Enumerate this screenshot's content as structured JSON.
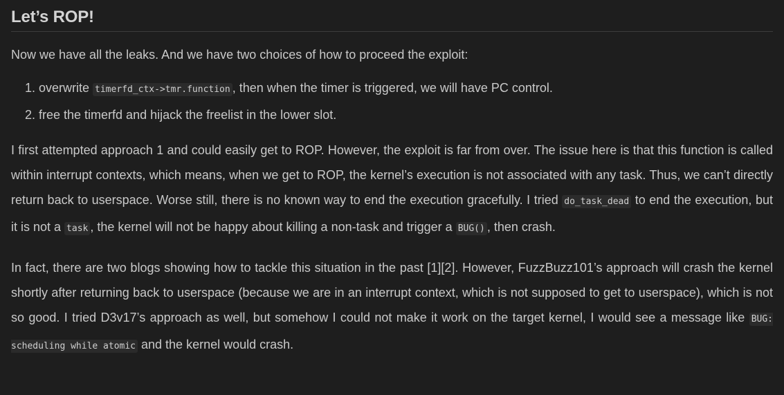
{
  "title": "Let’s ROP!",
  "intro": "Now we have all the leaks. And we have two choices of how to proceed the exploit:",
  "choices": [
    {
      "before": "overwrite ",
      "code": "timerfd_ctx->tmr.function",
      "after": ", then when the timer is triggered, we will have PC control."
    },
    {
      "text": "free the timerfd and hijack the freelist in the lower slot."
    }
  ],
  "para1": {
    "t1": "I first attempted approach 1 and could easily get to ROP. However, the exploit is far from over. The issue here is that this function is called within interrupt contexts, which means, when we get to ROP, the kernel’s execution is not associated with any task. Thus, we can’t directly return back to userspace. Worse still, there is no known way to end the execution gracefully. I tried ",
    "c1": "do_task_dead",
    "t2": " to end the execution, but it is not a ",
    "c2": "task",
    "t3": ", the kernel will not be happy about killing a non-task and trigger a ",
    "c3": "BUG()",
    "t4": ", then crash."
  },
  "para2": {
    "t1": "In fact, there are two blogs showing how to tackle this situation in the past [1][2]. However, FuzzBuzz101’s approach will crash the kernel shortly after returning back to userspace (because we are in an interrupt context, which is not supposed to get to userspace), which is not so good. I tried D3v17’s approach as well, but somehow I could not make it work on the target kernel, I would see a message like ",
    "c1": "BUG: scheduling while atomic",
    "t2": " and the kernel would crash."
  }
}
